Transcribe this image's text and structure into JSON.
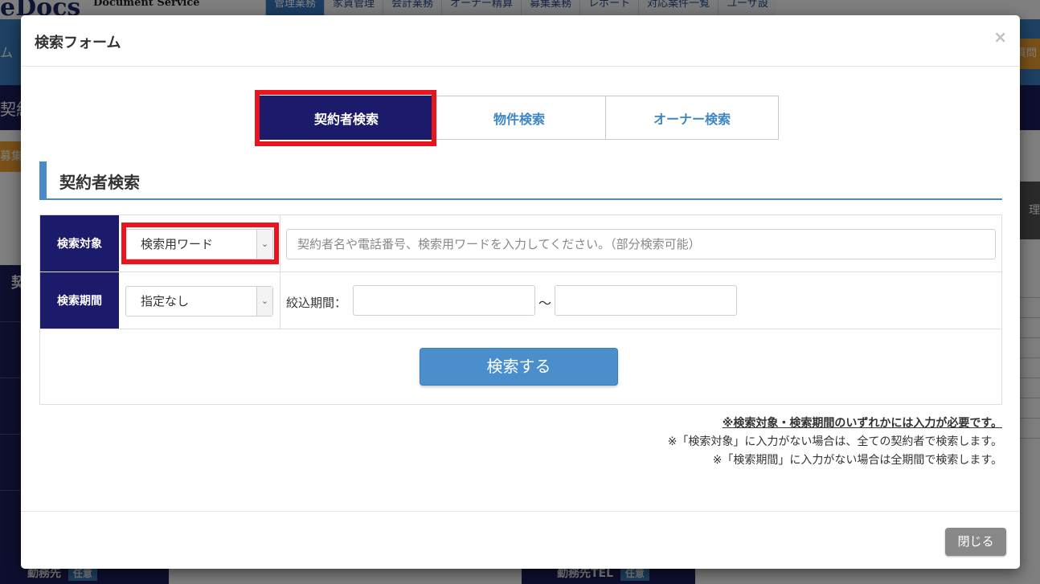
{
  "background": {
    "logo": "eDocs",
    "logo_sub": "Document Service",
    "nav": [
      "管理業務",
      "家賃管理",
      "会計業務",
      "オーナー精算",
      "募集業務",
      "レポート",
      "対応案件一覧",
      "ユーザ設"
    ],
    "left_bar_text": "ム",
    "question_btn": "質問",
    "dark_bar_text": "契約",
    "orange_tab": "募集",
    "right_btn": "理",
    "side_label": "契",
    "bottom_left_label": "勤務先",
    "bottom_right_label": "勤務先TEL",
    "optional_tag": "任意"
  },
  "modal": {
    "title": "検索フォーム",
    "close_icon": "×",
    "tabs": [
      {
        "label": "契約者検索",
        "active": true
      },
      {
        "label": "物件検索",
        "active": false
      },
      {
        "label": "オーナー検索",
        "active": false
      }
    ],
    "section_heading": "契約者検索",
    "form": {
      "target": {
        "label": "検索対象",
        "select_value": "検索用ワード",
        "input_value": "",
        "placeholder": "契約者名や電話番号、検索用ワードを入力してください。（部分検索可能）"
      },
      "period": {
        "label": "検索期間",
        "select_value": "指定なし",
        "range_label": "絞込期間：",
        "separator": "～",
        "from_value": "",
        "to_value": ""
      },
      "submit_label": "検索する"
    },
    "notes": {
      "required": "※検索対象・検索期間のいずれかには入力が必要です。",
      "target_note": "※「検索対象」に入力がない場合は、全ての契約者で検索します。",
      "period_note": "※「検索期間」に入力がない場合は全期間で検索します。"
    },
    "footer": {
      "close_label": "閉じる"
    }
  },
  "colors": {
    "navy": "#1c1a6b",
    "accent_blue": "#4a8fcb",
    "highlight_red": "#e8141e",
    "close_gray": "#888888"
  }
}
